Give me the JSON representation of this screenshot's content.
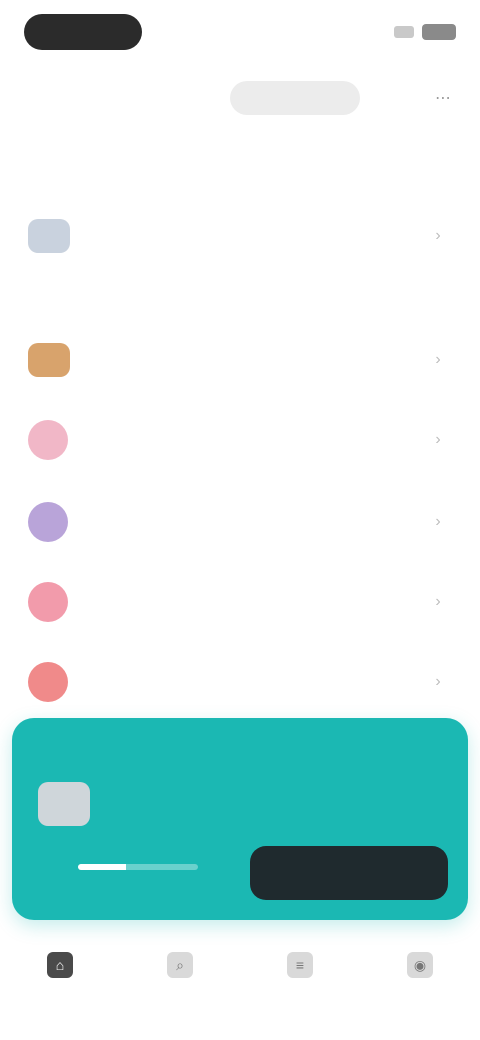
{
  "status_bar": {
    "time": "",
    "signal_icon": "signal-icon",
    "battery_icon": "battery-icon"
  },
  "tabs": [
    {
      "label": ""
    },
    {
      "label": ""
    }
  ],
  "more_icon": "more-icon",
  "sections": {
    "recent_label": "",
    "items_label": ""
  },
  "list": [
    {
      "title": "",
      "subtitle": "",
      "thumb_color": "#c9d2de",
      "round": false
    },
    {
      "title": "",
      "subtitle": "",
      "thumb_color": "#d8a36c",
      "round": false
    },
    {
      "title": "",
      "subtitle": "",
      "thumb_color": "#f1b7c7",
      "round": true
    },
    {
      "title": "",
      "subtitle": "",
      "thumb_color": "#b9a4d9",
      "round": true
    },
    {
      "title": "",
      "subtitle": "",
      "thumb_color": "#f29bab",
      "round": true
    },
    {
      "title": "",
      "subtitle": "",
      "thumb_color": "#f08a8a",
      "round": true
    }
  ],
  "player": {
    "label": "",
    "title": "",
    "artist": "",
    "progress": 0.4,
    "button_label": "",
    "accent_color": "#1bb8b3"
  },
  "bottom_nav": [
    {
      "label": "",
      "icon": "home-icon",
      "active": true
    },
    {
      "label": "",
      "icon": "search-icon",
      "active": false
    },
    {
      "label": "",
      "icon": "library-icon",
      "active": false
    },
    {
      "label": "",
      "icon": "profile-icon",
      "active": false
    }
  ]
}
